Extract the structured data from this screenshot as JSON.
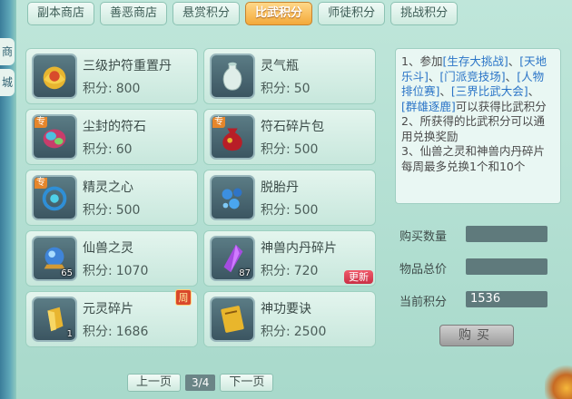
{
  "side_tabs": [
    "商",
    "城"
  ],
  "tabs": [
    {
      "label": "副本商店",
      "active": false
    },
    {
      "label": "善恶商店",
      "active": false
    },
    {
      "label": "悬赏积分",
      "active": false
    },
    {
      "label": "比武积分",
      "active": true
    },
    {
      "label": "师徒积分",
      "active": false
    },
    {
      "label": "挑战积分",
      "active": false
    }
  ],
  "score_label": "积分:",
  "items": [
    {
      "name": "三级护符重置丹",
      "score": "800",
      "icon": "lotus-pill-icon",
      "special": "",
      "quantity": "",
      "badge_new": "",
      "badge_week": ""
    },
    {
      "name": "灵气瓶",
      "score": "50",
      "icon": "vase-icon",
      "special": "",
      "quantity": "",
      "badge_new": "",
      "badge_week": ""
    },
    {
      "name": "尘封的符石",
      "score": "60",
      "icon": "rune-stone-icon",
      "special": "专",
      "quantity": "",
      "badge_new": "",
      "badge_week": ""
    },
    {
      "name": "符石碎片包",
      "score": "500",
      "icon": "red-bag-icon",
      "special": "专",
      "quantity": "",
      "badge_new": "",
      "badge_week": ""
    },
    {
      "name": "精灵之心",
      "score": "500",
      "icon": "spirit-heart-icon",
      "special": "专",
      "quantity": "",
      "badge_new": "",
      "badge_week": ""
    },
    {
      "name": "脱胎丹",
      "score": "500",
      "icon": "blue-pills-icon",
      "special": "",
      "quantity": "",
      "badge_new": "",
      "badge_week": ""
    },
    {
      "name": "仙兽之灵",
      "score": "1070",
      "icon": "beast-orb-icon",
      "special": "",
      "quantity": "65",
      "badge_new": "",
      "badge_week": ""
    },
    {
      "name": "神兽内丹碎片",
      "score": "720",
      "icon": "purple-crystal-icon",
      "special": "",
      "quantity": "87",
      "badge_new": "更新",
      "badge_week": ""
    },
    {
      "name": "元灵碎片",
      "score": "1686",
      "icon": "gold-shard-icon",
      "special": "",
      "quantity": "1",
      "badge_new": "",
      "badge_week": "周"
    },
    {
      "name": "神功要诀",
      "score": "2500",
      "icon": "golden-book-icon",
      "special": "",
      "quantity": "",
      "badge_new": "",
      "badge_week": ""
    }
  ],
  "info": {
    "line1_prefix": "1、参加",
    "events": [
      "[生存大挑战]",
      "[天地乐斗]",
      "[门派竞技场]",
      "[人物排位赛]",
      "[三界比武大会]",
      "[群雄逐鹿]"
    ],
    "line1_suffix": "可以获得比武积分",
    "line2": "2、所获得的比武积分可以通用兑换奖励",
    "line3": "3、仙兽之灵和神兽内丹碎片每周最多兑换1个和10个"
  },
  "fields": {
    "quantity_label": "购买数量",
    "quantity_value": "",
    "total_label": "物品总价",
    "total_value": "",
    "current_label": "当前积分",
    "current_value": "1536"
  },
  "buy_label": "购买",
  "pager": {
    "prev": "上一页",
    "page": "3/4",
    "next": "下一页"
  },
  "colors": {
    "active_tab": "#f3a93a",
    "link_blue": "#2a74c7",
    "new_badge": "#d9384c"
  }
}
